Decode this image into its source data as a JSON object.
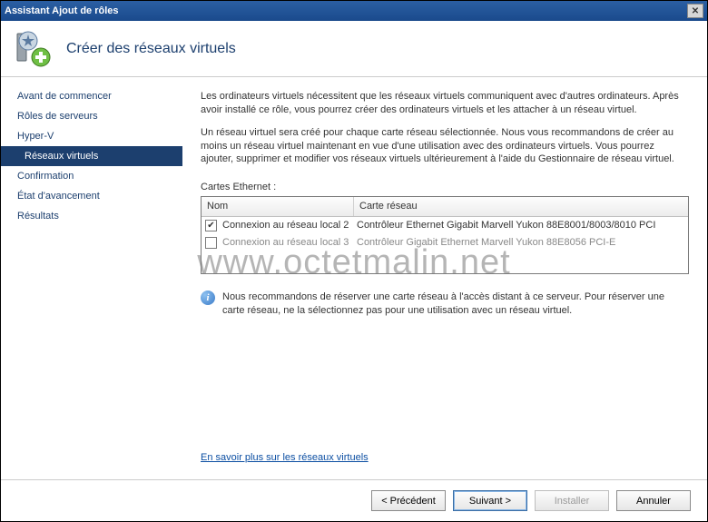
{
  "window": {
    "title": "Assistant Ajout de rôles"
  },
  "header": {
    "title": "Créer des réseaux virtuels"
  },
  "sidebar": {
    "items": [
      {
        "label": "Avant de commencer",
        "selected": false,
        "sub": false
      },
      {
        "label": "Rôles de serveurs",
        "selected": false,
        "sub": false
      },
      {
        "label": "Hyper-V",
        "selected": false,
        "sub": false
      },
      {
        "label": "Réseaux virtuels",
        "selected": true,
        "sub": true
      },
      {
        "label": "Confirmation",
        "selected": false,
        "sub": false
      },
      {
        "label": "État d'avancement",
        "selected": false,
        "sub": false
      },
      {
        "label": "Résultats",
        "selected": false,
        "sub": false
      }
    ]
  },
  "content": {
    "para1": "Les ordinateurs virtuels nécessitent que les réseaux virtuels communiquent avec d'autres ordinateurs. Après avoir installé ce rôle, vous pourrez créer des ordinateurs virtuels et les attacher à un réseau virtuel.",
    "para2": "Un réseau virtuel sera créé pour chaque carte réseau sélectionnée. Nous vous recommandons de créer au moins un réseau virtuel maintenant en vue d'une utilisation avec des ordinateurs virtuels. Vous pourrez ajouter, supprimer et modifier vos réseaux virtuels ultérieurement à l'aide du Gestionnaire de réseau virtuel.",
    "section_label": "Cartes Ethernet :",
    "table": {
      "headers": {
        "name": "Nom",
        "card": "Carte réseau"
      },
      "rows": [
        {
          "checked": true,
          "name": "Connexion au réseau local 2",
          "card": "Contrôleur Ethernet Gigabit Marvell Yukon 88E8001/8003/8010 PCI"
        },
        {
          "checked": false,
          "name": "Connexion au réseau local 3",
          "card": "Contrôleur Gigabit Ethernet Marvell Yukon 88E8056 PCI-E"
        }
      ]
    },
    "info_text": "Nous recommandons de réserver une carte réseau à l'accès distant à ce serveur. Pour réserver une carte réseau, ne la sélectionnez pas pour une utilisation avec un réseau virtuel.",
    "link": "En savoir plus sur les réseaux virtuels"
  },
  "footer": {
    "prev": "< Précédent",
    "next": "Suivant >",
    "install": "Installer",
    "cancel": "Annuler"
  },
  "watermark": "www.octetmalin.net"
}
